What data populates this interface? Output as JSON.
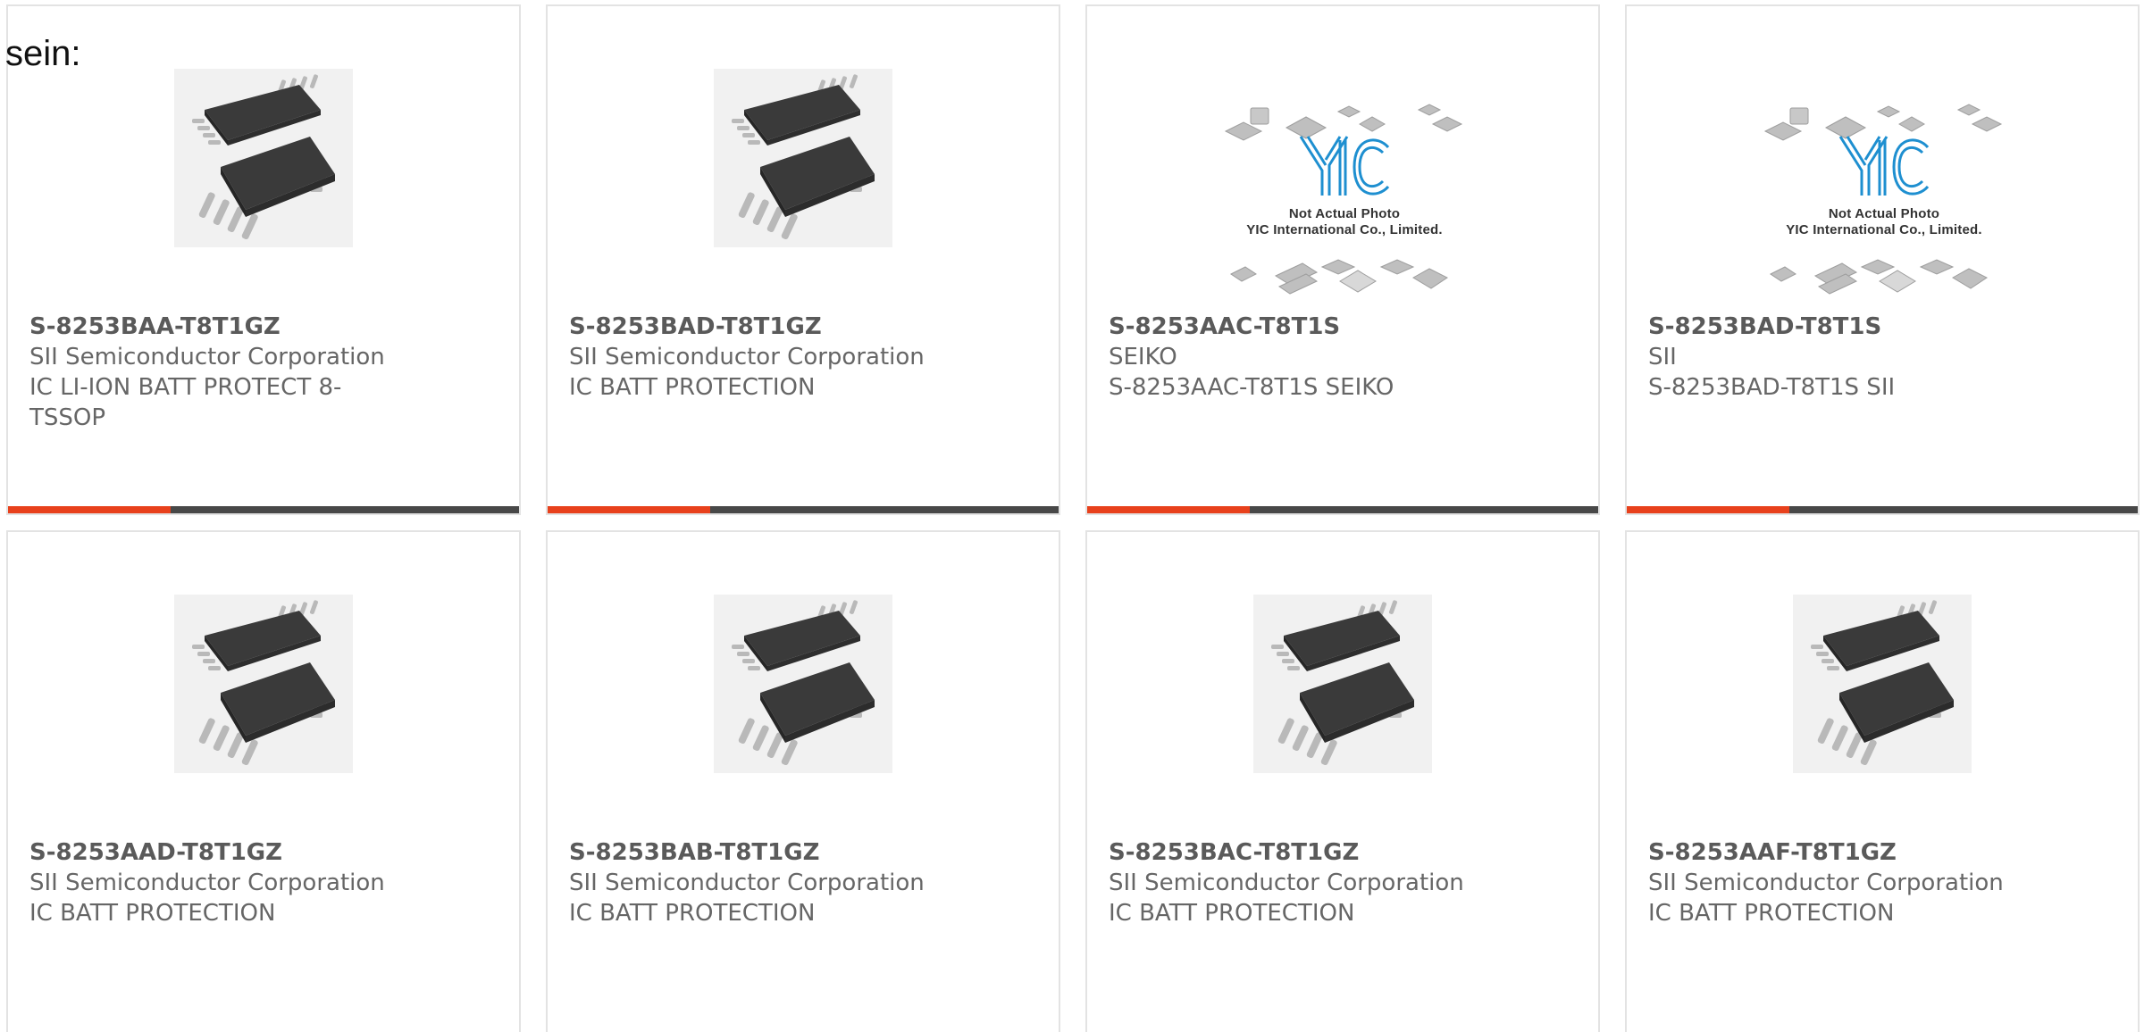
{
  "heading": "sein:",
  "placeholder": {
    "logo_text": "YIC",
    "line1": "Not Actual Photo",
    "line2": "YIC International Co., Limited."
  },
  "colors": {
    "accent": "#e8411c",
    "bar": "#484848",
    "border": "#e3e3e3",
    "part_text": "#5a5a5a",
    "body_text": "#666666",
    "logo_blue": "#1e8fd0"
  },
  "products": [
    {
      "part_number": "S-8253BAA-T8T1GZ",
      "manufacturer": "SII Semiconductor Corporation",
      "description": "IC LI-ION BATT PROTECT 8-TSSOP",
      "image": "tssop-chip-photo"
    },
    {
      "part_number": "S-8253BAD-T8T1GZ",
      "manufacturer": "SII Semiconductor Corporation",
      "description": "IC BATT PROTECTION",
      "image": "tssop-chip-photo"
    },
    {
      "part_number": "S-8253AAC-T8T1S",
      "manufacturer": "SEIKO",
      "description": "S-8253AAC-T8T1S SEIKO",
      "image": "not-actual-photo-placeholder"
    },
    {
      "part_number": "S-8253BAD-T8T1S",
      "manufacturer": "SII",
      "description": "S-8253BAD-T8T1S SII",
      "image": "not-actual-photo-placeholder"
    },
    {
      "part_number": "S-8253AAD-T8T1GZ",
      "manufacturer": "SII Semiconductor Corporation",
      "description": "IC BATT PROTECTION",
      "image": "tssop-chip-photo"
    },
    {
      "part_number": "S-8253BAB-T8T1GZ",
      "manufacturer": "SII Semiconductor Corporation",
      "description": "IC BATT PROTECTION",
      "image": "tssop-chip-photo"
    },
    {
      "part_number": "S-8253BAC-T8T1GZ",
      "manufacturer": "SII Semiconductor Corporation",
      "description": "IC BATT PROTECTION",
      "image": "tssop-chip-photo"
    },
    {
      "part_number": "S-8253AAF-T8T1GZ",
      "manufacturer": "SII Semiconductor Corporation",
      "description": "IC BATT PROTECTION",
      "image": "tssop-chip-photo"
    }
  ]
}
